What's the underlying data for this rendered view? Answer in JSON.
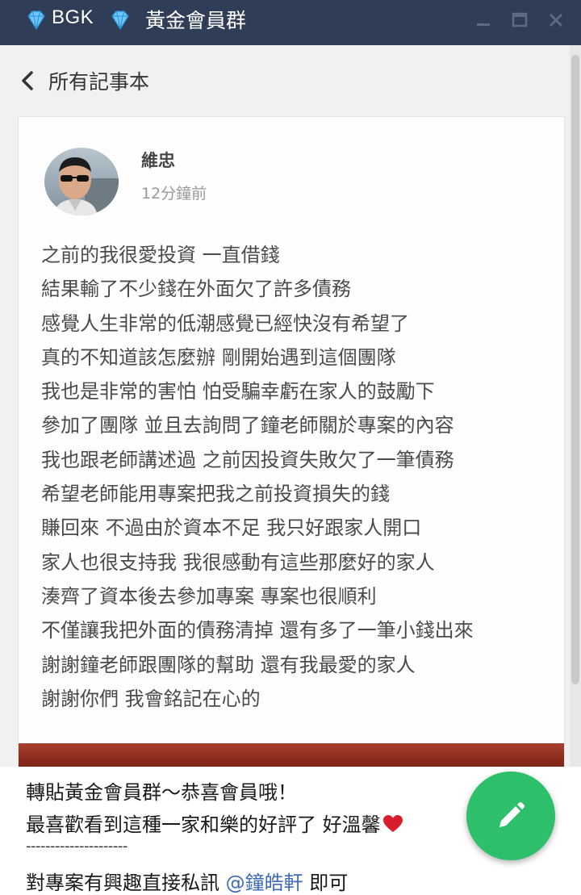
{
  "window": {
    "brand": "BGK",
    "group_name": "黃金會員群",
    "colors": {
      "titlebar": "#2f3d57",
      "diamond": "#6ec6ff"
    }
  },
  "nav": {
    "back_label": "所有記事本"
  },
  "post": {
    "author": "維忠",
    "time_ago": "12分鐘前",
    "lines": [
      "之前的我很愛投資 一直借錢",
      "結果輸了不少錢在外面欠了許多債務",
      "感覺人生非常的低潮感覺已經快沒有希望了",
      "真的不知道該怎麼辦 剛開始遇到這個團隊",
      "我也是非常的害怕 怕受騙幸虧在家人的鼓勵下",
      "參加了團隊 並且去詢問了鐘老師關於專案的內容",
      "我也跟老師講述過 之前因投資失敗欠了一筆債務",
      "希望老師能用專案把我之前投資損失的錢",
      "賺回來 不過由於資本不足 我只好跟家人開口",
      "家人也很支持我 我很感動有這些那麼好的家人",
      "湊齊了資本後去參加專案 專案也很順利",
      "不僅讓我把外面的債務清掉 還有多了一筆小錢出來",
      "謝謝鐘老師跟團隊的幫助 還有我最愛的家人",
      "謝謝你們 我會銘記在心的"
    ]
  },
  "caption": {
    "line1": "轉貼黃金會員群～恭喜會員哦！",
    "line2": "最喜歡看到這種一家和樂的好評了 好溫馨",
    "divider": "---------------------",
    "line4_prefix": "對專案有興趣直接私訊 ",
    "mention": "@鐘皓軒",
    "line4_suffix": " 即可"
  },
  "fab": {
    "icon": "pencil-icon",
    "color": "#2ebf6a"
  }
}
